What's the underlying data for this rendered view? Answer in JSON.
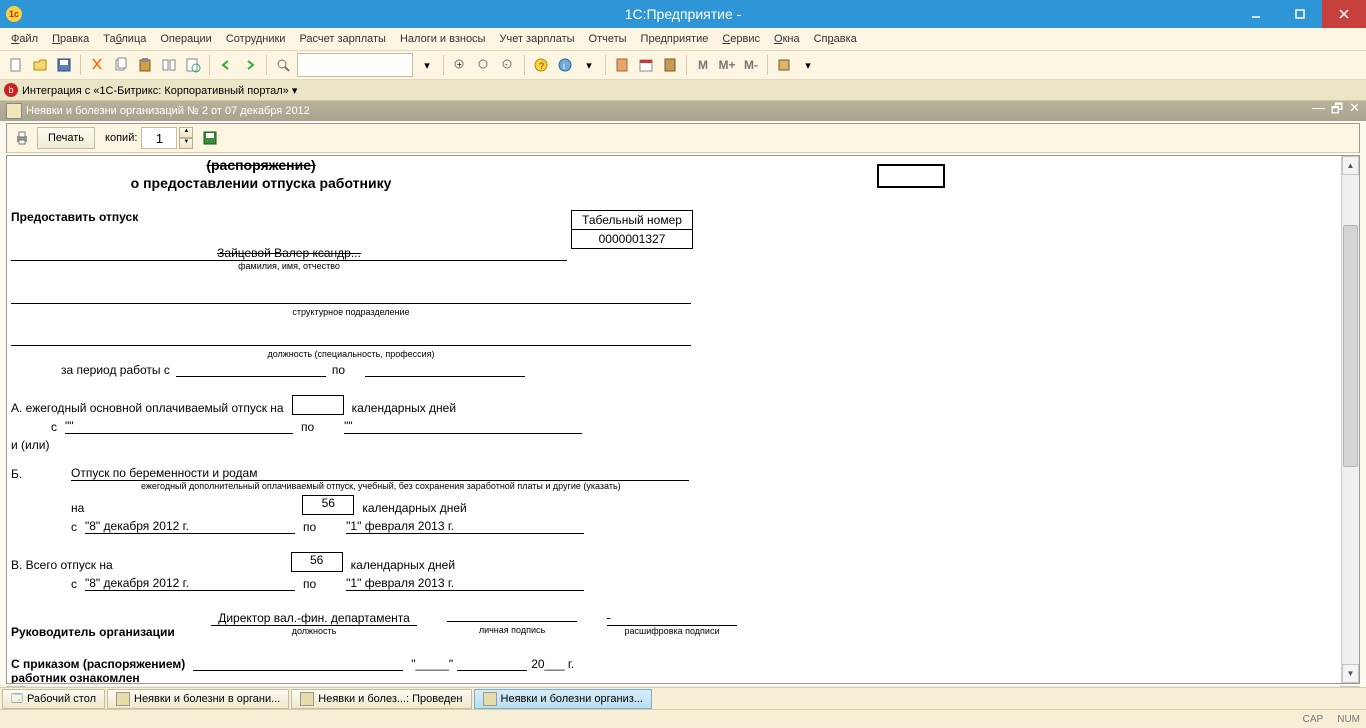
{
  "window": {
    "title": "1C:Предприятие -           "
  },
  "menu": {
    "items": [
      "Файл",
      "Правка",
      "Таблица",
      "Операции",
      "Сотрудники",
      "Расчет зарплаты",
      "Налоги и взносы",
      "Учет зарплаты",
      "Отчеты",
      "Предприятие",
      "Сервис",
      "Окна",
      "Справка"
    ]
  },
  "toolbar": {
    "M": "M",
    "Mplus": "M+",
    "Mminus": "M-"
  },
  "panel": {
    "bitrix": "Интеграция с «1С-Битрикс: Корпоративный портал» ▾"
  },
  "tab": {
    "title": "Неявки и болезни организаций № 2 от 07 декабря 2012"
  },
  "print": {
    "button": "Печать",
    "copies_label": "копий:",
    "copies_value": "1"
  },
  "form": {
    "order_line1": "(распоряжение)",
    "order_line2": "о предоставлении отпуска работнику",
    "grant_leave": "Предоставить отпуск",
    "tab_number_hdr": "Табельный номер",
    "tab_number_val": "0000001327",
    "fio_partial": "Зайцевой Валер                 ксандр...",
    "fio_caption": "фамилия, имя, отчество",
    "dept_caption": "структурное подразделение",
    "position_caption": "должность (специальность, профессия)",
    "period_label": "за период работы с",
    "po": "по",
    "A_label": "А. ежегодный основной оплачиваемый отпуск на",
    "cal_days": "календарных дней",
    "s": "с",
    "quote_empty": "\"\"",
    "iili": "и (или)",
    "B_label": "Б.",
    "B_text": "Отпуск по беременности и родам",
    "B_caption": "ежегодный дополнительный оплачиваемый отпуск, учебный, без сохранения заработной платы и другие (указать)",
    "na": "на",
    "days56": "56",
    "date_from": "\"8\" декабря 2012 г.",
    "date_to": "\"1\" февраля 2013 г.",
    "V_label": "В.   Всего отпуск на",
    "head_label": "Руководитель организации",
    "head_pos": "Директор вал.-фин. департамента",
    "sig_position": "должность",
    "sig_signature": "личная подпись",
    "sig_decode": "расшифровка подписи",
    "acq1": "С приказом (распоряжением)",
    "acq2": "работник  ознакомлен",
    "year20": "20___ г.",
    "quote1": "\"_____\"",
    "blank_month": "________________"
  },
  "taskbar": {
    "tabs": [
      "Рабочий стол",
      "Неявки и болезни в органи...",
      "Неявки и болез...: Проведен",
      "Неявки и болезни организ..."
    ]
  },
  "status": {
    "cap": "CAP",
    "num": "NUM"
  }
}
